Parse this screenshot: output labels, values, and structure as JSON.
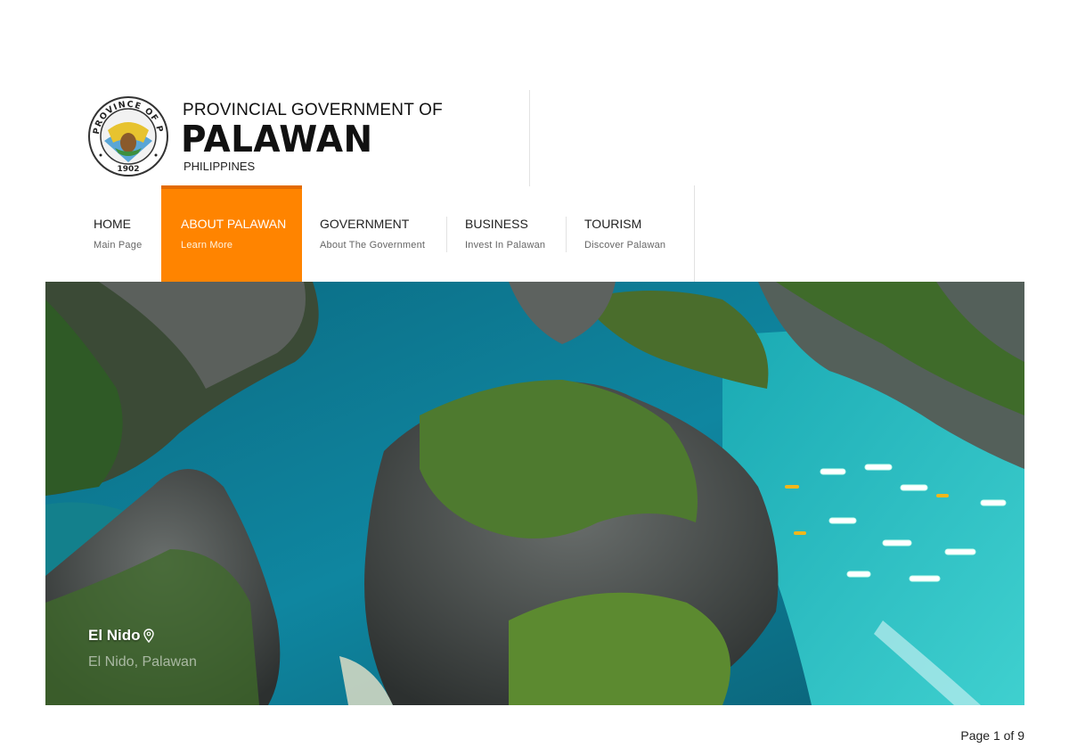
{
  "header": {
    "title_top": "PROVINCIAL GOVERNMENT OF",
    "title_main": "PALAWAN",
    "title_sub": "PHILIPPINES",
    "seal": {
      "ring_text": "PROVINCE OF PALAWAN",
      "year": "1902",
      "icon": "provincial-seal"
    }
  },
  "nav": {
    "items": [
      {
        "label": "HOME",
        "sub": "Main Page",
        "active": false
      },
      {
        "label": "ABOUT PALAWAN",
        "sub": "Learn More",
        "active": true
      },
      {
        "label": "GOVERNMENT",
        "sub": "About The Government",
        "active": false
      },
      {
        "label": "BUSINESS",
        "sub": "Invest In Palawan",
        "active": false
      },
      {
        "label": "TOURISM",
        "sub": "Discover Palawan",
        "active": false
      }
    ],
    "active_color": "#ff8400"
  },
  "hero": {
    "caption_title": "El Nido",
    "caption_icon": "location-pin-icon",
    "caption_sub": "El Nido, Palawan",
    "colors": {
      "water": "#1fb8bf",
      "deep_water": "#0d6f7a",
      "rock": "#4a4f4e",
      "foliage": "#3f6b2a"
    }
  },
  "footer": {
    "page_label": "Page 1 of 9"
  }
}
